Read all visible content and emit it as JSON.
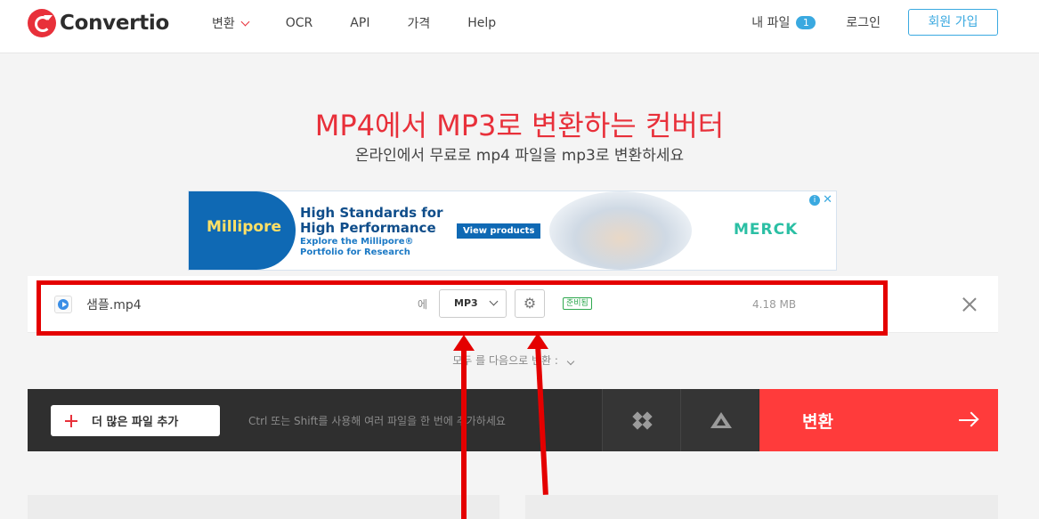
{
  "app": {
    "logo_text": "Convertio"
  },
  "nav": {
    "items": [
      {
        "label": "변환"
      },
      {
        "label": "OCR"
      },
      {
        "label": "API"
      },
      {
        "label": "가격"
      },
      {
        "label": "Help"
      }
    ],
    "my_files_label": "내 파일",
    "my_files_count": "1",
    "login_label": "로그인",
    "signup_label": "회원 가입"
  },
  "hero": {
    "title": "MP4에서 MP3로 변환하는 컨버터",
    "subtitle": "온라인에서 무료로 mp4 파일을 mp3로 변환하세요"
  },
  "ad": {
    "brand": "Millipore",
    "headline": "High Standards for High Performance",
    "subline": "Explore the Millipore® Portfolio for Research",
    "cta": "View products",
    "partner": "MERCK"
  },
  "file": {
    "name": "샘플.mp4",
    "to_label": "에",
    "format": "MP3",
    "status": "준비됨",
    "size": "4.18 MB"
  },
  "convert_all": {
    "label": "모두 를 다음으로 변환 :"
  },
  "toolbar": {
    "add_files_label": "더 많은 파일 추가",
    "hint": "Ctrl 또는 Shift를 사용해 여러 파일을 한 번에 추가하세요",
    "convert_label": "변환"
  },
  "colors": {
    "accent_red": "#e8303a",
    "convert_red": "#ff3b3b",
    "link_blue": "#3aa9e0",
    "annotation_red": "#e40000"
  }
}
